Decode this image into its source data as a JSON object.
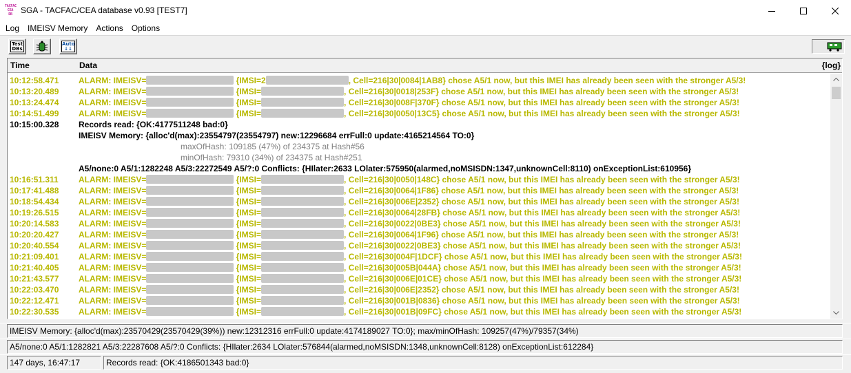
{
  "window": {
    "title": "SGA - TACFAC/CEA database  v0.93  [TEST7]",
    "minimize_glyph": "—",
    "maximize_glyph": "☐",
    "close_glyph": "✕"
  },
  "menu": [
    {
      "label": "Log"
    },
    {
      "label": "IMEISV Memory"
    },
    {
      "label": "Actions"
    },
    {
      "label": "Options"
    }
  ],
  "toolbar": {
    "buttons": [
      {
        "icon": "test-dbs-icon",
        "label": "Test DBs"
      },
      {
        "icon": "bug-icon",
        "label": ""
      },
      {
        "icon": "auto-icon",
        "label": "Auto"
      }
    ],
    "status_icon": "train-icon"
  },
  "log": {
    "columns": {
      "time": "Time",
      "data": "Data",
      "log": "{log}"
    },
    "rows": [
      {
        "kind": "alarm",
        "time": "10:12:58.471",
        "pre": "ALARM: IMEISV=",
        "mid": " {IMSI=2",
        "post": ", Cell=216|30|0084|1AB8} chose A5/1 now, but this IMEI has already been seen with the stronger A5/3!"
      },
      {
        "kind": "alarm",
        "time": "10:13:20.489",
        "pre": "ALARM: IMEISV=",
        "mid": " {IMSI=",
        "post": ", Cell=216|30|0018|253F} chose A5/1 now, but this IMEI has already been seen with the stronger A5/3!"
      },
      {
        "kind": "alarm",
        "time": "10:13:24.474",
        "pre": "ALARM: IMEISV=",
        "mid": " {IMSI=",
        "post": ", Cell=216|30|008F|370F} chose A5/1 now, but this IMEI has already been seen with the stronger A5/3!"
      },
      {
        "kind": "alarm",
        "time": "10:14:51.499",
        "pre": "ALARM: IMEISV=",
        "mid": " {IMSI=",
        "post": ", Cell=216|30|0050|13C5} chose A5/1 now, but this IMEI has already been seen with the stronger A5/3!"
      },
      {
        "kind": "normal",
        "time": "10:15:00.328",
        "text": "Records read:  {OK:4177511248  bad:0}"
      },
      {
        "kind": "normal",
        "time": "",
        "text": "IMEISV Memory:  {alloc'd(max):23554797(23554797)  new:12296684  errFull:0  update:4165214564  TO:0}"
      },
      {
        "kind": "grey",
        "time": "",
        "text": "maxOfHash: 109185 (47%) of 234375 at Hash#56"
      },
      {
        "kind": "grey",
        "time": "",
        "text": "minOfHash: 79310 (34%) of 234375 at Hash#251"
      },
      {
        "kind": "normal",
        "time": "",
        "text": "A5/none:0   A5/1:1282248   A5/3:22272549   A5/?:0   Conflicts:  {HIlater:2633  LOlater:575950(alarmed,noMSISDN:1347,unknownCell:8110)  onExceptionList:610956}"
      },
      {
        "kind": "alarm",
        "time": "10:16:51.311",
        "pre": "ALARM: IMEISV=",
        "mid": " {IMSI=",
        "post": ", Cell=216|30|0050|148C} chose A5/1 now, but this IMEI has already been seen with the stronger A5/3!"
      },
      {
        "kind": "alarm",
        "time": "10:17:41.488",
        "pre": "ALARM: IMEISV=",
        "mid": " {IMSI=",
        "post": ", Cell=216|30|0064|1F86} chose A5/1 now, but this IMEI has already been seen with the stronger A5/3!"
      },
      {
        "kind": "alarm",
        "time": "10:18:54.434",
        "pre": "ALARM: IMEISV=",
        "mid": " {IMSI=",
        "post": ", Cell=216|30|006E|2352} chose A5/1 now, but this IMEI has already been seen with the stronger A5/3!"
      },
      {
        "kind": "alarm",
        "time": "10:19:26.515",
        "pre": "ALARM: IMEISV=",
        "mid": " {IMSI=",
        "post": ", Cell=216|30|0064|28FB} chose A5/1 now, but this IMEI has already been seen with the stronger A5/3!"
      },
      {
        "kind": "alarm",
        "time": "10:20:14.583",
        "pre": "ALARM: IMEISV=",
        "mid": " {IMSI=",
        "post": ", Cell=216|30|0022|0BE3} chose A5/1 now, but this IMEI has already been seen with the stronger A5/3!"
      },
      {
        "kind": "alarm",
        "time": "10:20:20.427",
        "pre": "ALARM: IMEISV=",
        "mid": " {IMSI=",
        "post": ", Cell=216|30|0064|1F96} chose A5/1 now, but this IMEI has already been seen with the stronger A5/3!"
      },
      {
        "kind": "alarm",
        "time": "10:20:40.554",
        "pre": "ALARM: IMEISV=",
        "mid": " {IMSI=",
        "post": ", Cell=216|30|0022|0BE3} chose A5/1 now, but this IMEI has already been seen with the stronger A5/3!"
      },
      {
        "kind": "alarm",
        "time": "10:21:09.401",
        "pre": "ALARM: IMEISV=",
        "mid": " {IMSI=",
        "post": ", Cell=216|30|004F|1DCF} chose A5/1 now, but this IMEI has already been seen with the stronger A5/3!"
      },
      {
        "kind": "alarm",
        "time": "10:21:40.405",
        "pre": "ALARM: IMEISV=",
        "mid": " {IMSI=",
        "post": ", Cell=216|30|005B|044A} chose A5/1 now, but this IMEI has already been seen with the stronger A5/3!"
      },
      {
        "kind": "alarm",
        "time": "10:21:43.577",
        "pre": "ALARM: IMEISV=",
        "mid": " {IMSI=",
        "post": ", Cell=216|30|006E|01CE} chose A5/1 now, but this IMEI has already been seen with the stronger A5/3!"
      },
      {
        "kind": "alarm",
        "time": "10:22:03.470",
        "pre": "ALARM: IMEISV=",
        "mid": " {IMSI=",
        "post": ", Cell=216|30|006E|2352} chose A5/1 now, but this IMEI has already been seen with the stronger A5/3!"
      },
      {
        "kind": "alarm",
        "time": "10:22:12.471",
        "pre": "ALARM: IMEISV=",
        "mid": " {IMSI=",
        "post": ", Cell=216|30|001B|0836} chose A5/1 now, but this IMEI has already been seen with the stronger A5/3!"
      },
      {
        "kind": "alarm",
        "time": "10:22:30.535",
        "pre": "ALARM: IMEISV=",
        "mid": " {IMSI=",
        "post": ", Cell=216|30|001B|09FC} chose A5/1 now, but this IMEI has already been seen with the stronger A5/3!"
      }
    ]
  },
  "status": {
    "memory": "IMEISV Memory:  {alloc'd(max):23570429(23570429(39%))  new:12312316  errFull:0  update:4174189027  TO:0};  max/minOfHash: 109257(47%)/79357(34%)",
    "conflicts": "A5/none:0   A5/1:1282821   A5/3:22287608   A5/?:0   Conflicts:  {HIlater:2634  LOlater:576844(alarmed,noMSISDN:1348,unknownCell:8128)  onExceptionList:612284}",
    "uptime": "147 days, 16:47:17",
    "records": "Records read:  {OK:4186501343  bad:0}"
  },
  "colors": {
    "alarm": "#b8b800",
    "grey_text": "#808080"
  }
}
